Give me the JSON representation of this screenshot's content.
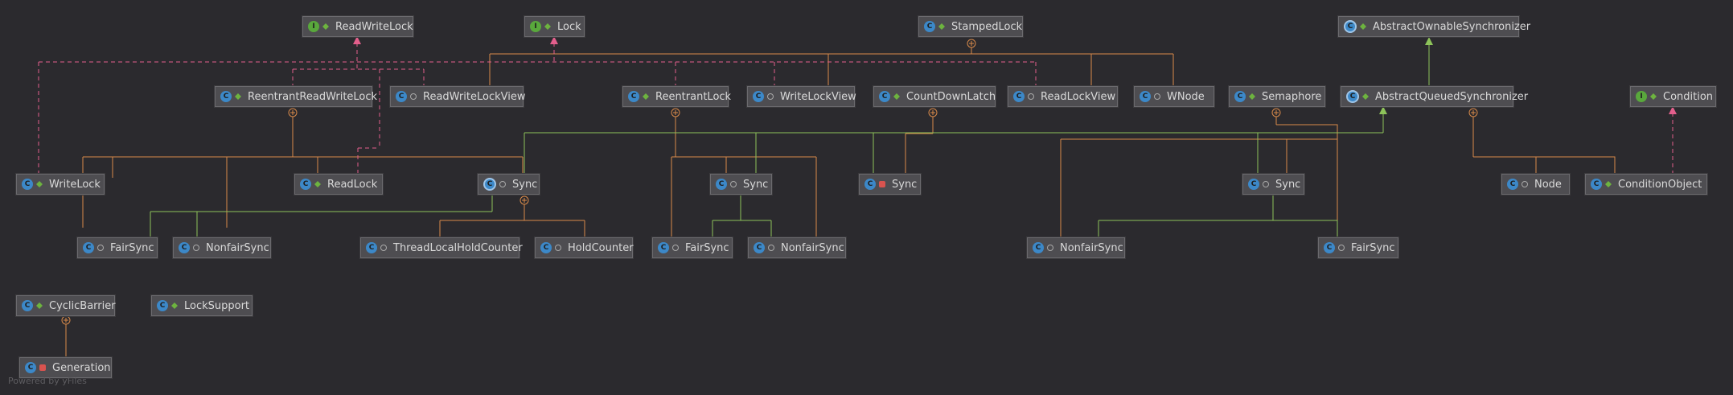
{
  "colors": {
    "background": "#2b2a2e",
    "node_fill": "#4e4d51",
    "node_border": "#6b6a6e",
    "extends_line": "#8dc35a",
    "implements_line": "#e35f8c",
    "inner_class_line": "#d88a4a"
  },
  "nodes": [
    {
      "id": "readwritelock",
      "label": "ReadWriteLock",
      "kind": "interface",
      "visibility": "public"
    },
    {
      "id": "lock",
      "label": "Lock",
      "kind": "interface",
      "visibility": "public"
    },
    {
      "id": "stampedlock",
      "label": "StampedLock",
      "kind": "class",
      "visibility": "public"
    },
    {
      "id": "abstractownablesynchronizer",
      "label": "AbstractOwnableSynchronizer",
      "kind": "abstract",
      "visibility": "public"
    },
    {
      "id": "reentrantreadwritelock",
      "label": "ReentrantReadWriteLock",
      "kind": "class",
      "visibility": "public"
    },
    {
      "id": "readwritelockview",
      "label": "ReadWriteLockView",
      "kind": "class",
      "visibility": "package"
    },
    {
      "id": "reentrantlock",
      "label": "ReentrantLock",
      "kind": "class",
      "visibility": "public"
    },
    {
      "id": "writelockview",
      "label": "WriteLockView",
      "kind": "class",
      "visibility": "package"
    },
    {
      "id": "countdownlatch",
      "label": "CountDownLatch",
      "kind": "class",
      "visibility": "public"
    },
    {
      "id": "readlockview",
      "label": "ReadLockView",
      "kind": "class",
      "visibility": "package"
    },
    {
      "id": "wnode",
      "label": "WNode",
      "kind": "class",
      "visibility": "package"
    },
    {
      "id": "semaphore",
      "label": "Semaphore",
      "kind": "class",
      "visibility": "public"
    },
    {
      "id": "aqs",
      "label": "AbstractQueuedSynchronizer",
      "kind": "abstract",
      "visibility": "public"
    },
    {
      "id": "condition",
      "label": "Condition",
      "kind": "interface",
      "visibility": "public"
    },
    {
      "id": "writelock",
      "label": "WriteLock",
      "kind": "class",
      "visibility": "public"
    },
    {
      "id": "readlock",
      "label": "ReadLock",
      "kind": "class",
      "visibility": "public"
    },
    {
      "id": "rrwl-sync",
      "label": "Sync",
      "kind": "abstract",
      "visibility": "package"
    },
    {
      "id": "rl-sync",
      "label": "Sync",
      "kind": "class",
      "visibility": "package"
    },
    {
      "id": "cdl-sync",
      "label": "Sync",
      "kind": "class",
      "visibility": "private"
    },
    {
      "id": "sem-sync",
      "label": "Sync",
      "kind": "class",
      "visibility": "package"
    },
    {
      "id": "node",
      "label": "Node",
      "kind": "class",
      "visibility": "package"
    },
    {
      "id": "conditionobject",
      "label": "ConditionObject",
      "kind": "class",
      "visibility": "public"
    },
    {
      "id": "rrwl-fairsync",
      "label": "FairSync",
      "kind": "class",
      "visibility": "package"
    },
    {
      "id": "rrwl-nonfairsync",
      "label": "NonfairSync",
      "kind": "class",
      "visibility": "package"
    },
    {
      "id": "threadlocalholdcounter",
      "label": "ThreadLocalHoldCounter",
      "kind": "class",
      "visibility": "package"
    },
    {
      "id": "holdcounter",
      "label": "HoldCounter",
      "kind": "class",
      "visibility": "package"
    },
    {
      "id": "rl-fairsync",
      "label": "FairSync",
      "kind": "class",
      "visibility": "package"
    },
    {
      "id": "rl-nonfairsync",
      "label": "NonfairSync",
      "kind": "class",
      "visibility": "package"
    },
    {
      "id": "sem-nonfairsync",
      "label": "NonfairSync",
      "kind": "class",
      "visibility": "package"
    },
    {
      "id": "sem-fairsync",
      "label": "FairSync",
      "kind": "class",
      "visibility": "package"
    },
    {
      "id": "cyclicbarrier",
      "label": "CyclicBarrier",
      "kind": "class",
      "visibility": "public"
    },
    {
      "id": "locksupport",
      "label": "LockSupport",
      "kind": "class",
      "visibility": "public"
    },
    {
      "id": "generation",
      "label": "Generation",
      "kind": "class",
      "visibility": "private"
    }
  ],
  "footer": "Powered by yFiles"
}
